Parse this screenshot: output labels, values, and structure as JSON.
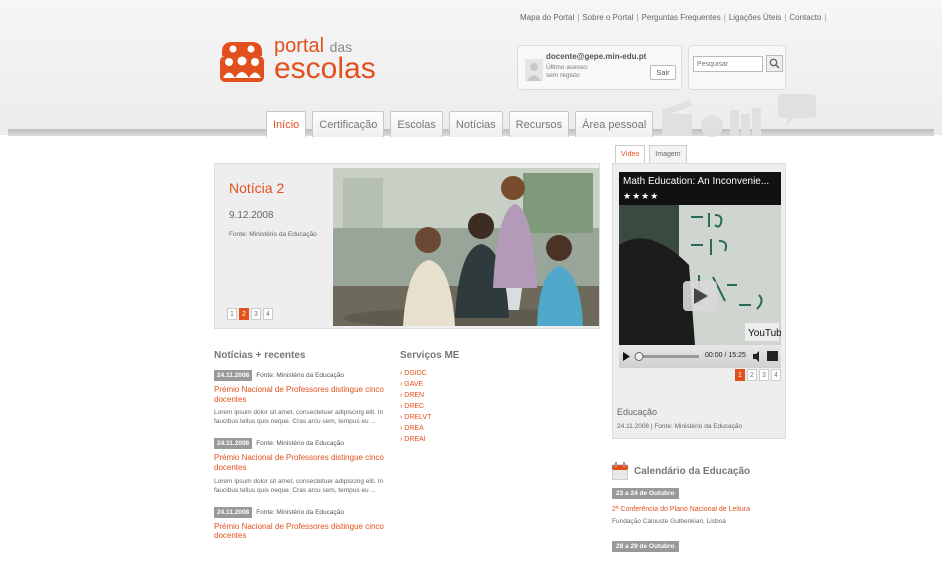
{
  "top_links": [
    "Mapa do Portal",
    "Sobre o Portal",
    "Perguntas Frequentes",
    "Ligações Úteis",
    "Contacto"
  ],
  "logo": {
    "line1": "portal",
    "line1_small": "das",
    "line2": "escolas",
    "brand_color": "#e2501d"
  },
  "login": {
    "user": "docente@gepe.min-edu.pt",
    "last_access_label": "Último acesso:",
    "last_access_value": "sem registo",
    "logout_label": "Sair"
  },
  "search": {
    "placeholder": "Pesquisar",
    "icon": "magnifier-icon"
  },
  "nav": {
    "tabs": [
      "Início",
      "Certificação",
      "Escolas",
      "Notícias",
      "Recursos",
      "Área pessoal"
    ],
    "active": 0
  },
  "feature": {
    "title": "Notícia 2",
    "date": "9.12.2008",
    "source": "Fonte: Ministério da Educação",
    "pages": [
      "1",
      "2",
      "3",
      "4"
    ],
    "active_page": 1
  },
  "news": {
    "heading": "Notícias + recentes",
    "items": [
      {
        "date": "24.11.2008",
        "source": "Fonte: Ministério da Educação",
        "title": "Prémio Nacional de Professores distingue cinco docentes",
        "excerpt": "Lorem ipsum dolor sit amet, consectetuer adipiscing elit. In faucibus tellus quis neque. Cras arcu sem, tempus eu ..."
      },
      {
        "date": "24.11.2008",
        "source": "Fonte: Ministério da Educação",
        "title": "Prémio Nacional de Professores distingue cinco docentes",
        "excerpt": "Lorem ipsum dolor sit amet, consectetuer adipiscing elit. In faucibus tellus quis neque. Cras arcu sem, tempus eu ..."
      },
      {
        "date": "24.11.2008",
        "source": "Fonte: Ministério da Educação",
        "title": "Prémio Nacional de Professores distingue cinco docentes",
        "excerpt": ""
      }
    ]
  },
  "services": {
    "heading": "Serviços ME",
    "items": [
      "DGIDC",
      "GAVE",
      "DREN",
      "DREC",
      "DRELVT",
      "DREA",
      "DREAl"
    ]
  },
  "media": {
    "tabs": [
      "Vídeo",
      "Imagem"
    ],
    "active_tab": 0,
    "video_title": "Math Education: An Inconvenie...",
    "stars": "★★★★",
    "time": "00:00 / 15:25",
    "brand": "YouTube",
    "pages": [
      "1",
      "2",
      "3",
      "4"
    ],
    "active_page": 0,
    "caption_title": "Educação",
    "caption_meta": "24.11.2008 | Fonte: Ministério da Educação"
  },
  "calendar": {
    "heading": "Calendário da Educação",
    "events": [
      {
        "date": "23 a 24 de Outubro",
        "title": "2ª Conferência do Plano Nacional de Leitura",
        "place": "Fundação Calouste Gulbenkian, Lisboa"
      },
      {
        "date": "28 a 29 de Outubro"
      }
    ]
  }
}
